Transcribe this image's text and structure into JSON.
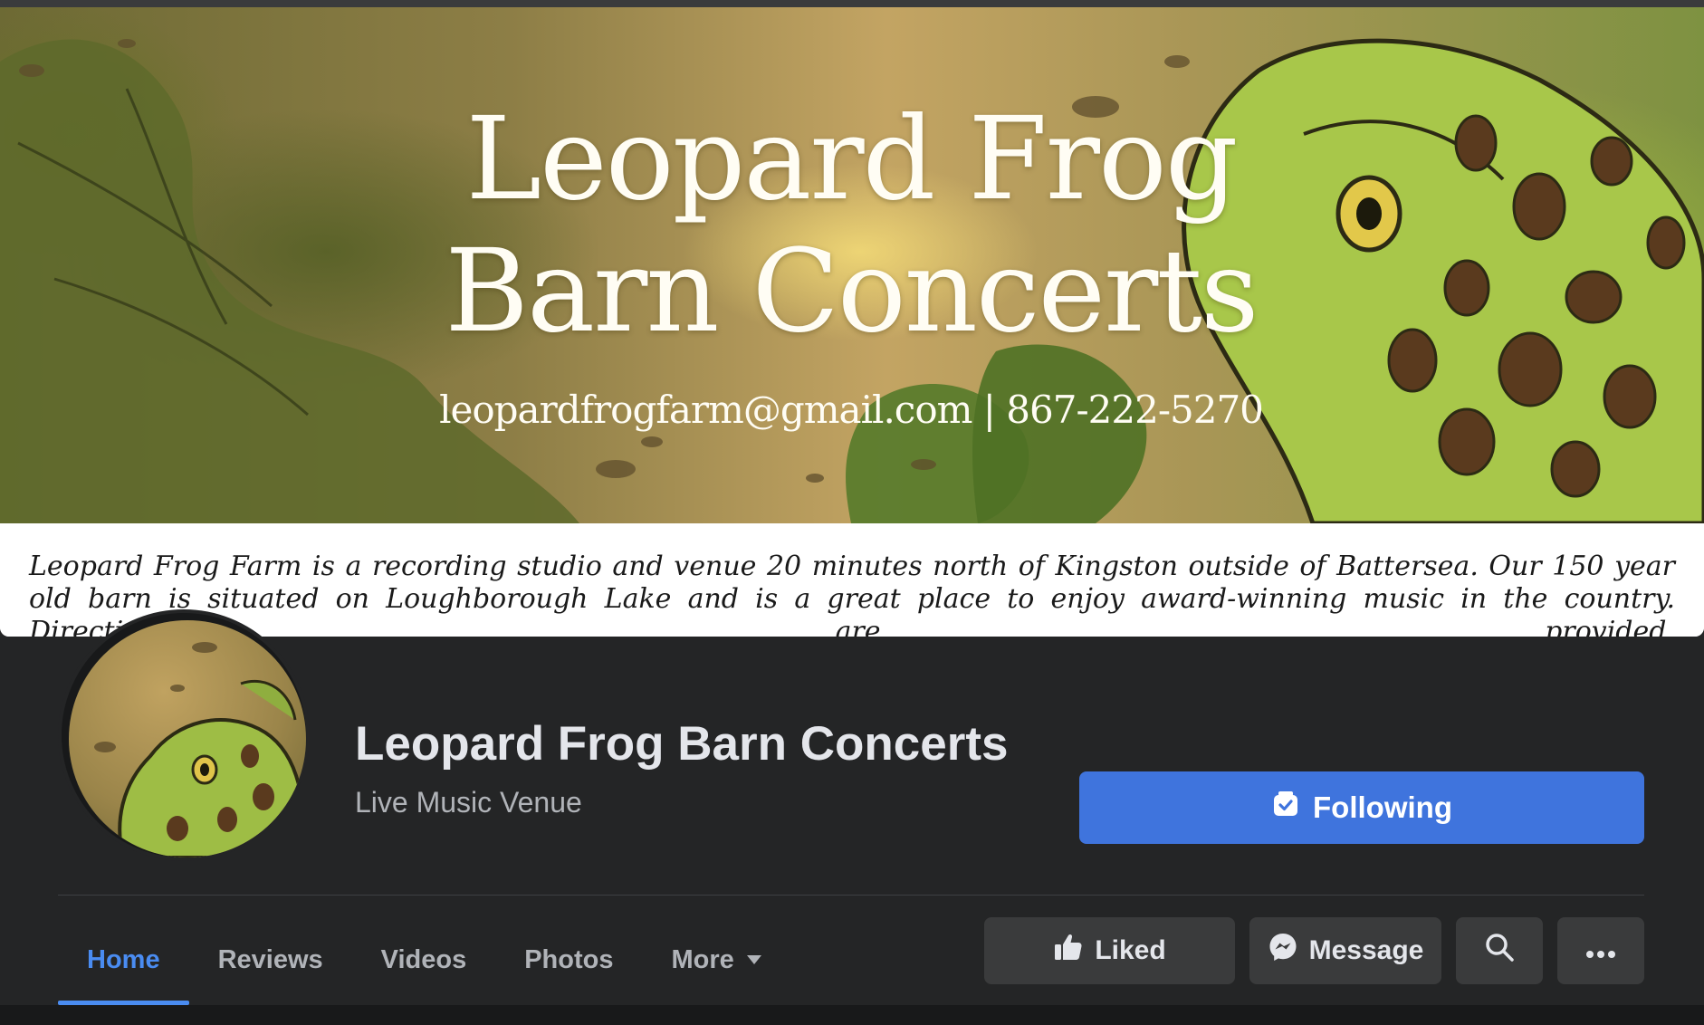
{
  "cover": {
    "title_line1": "Leopard Frog",
    "title_line2": "Barn Concerts",
    "contact": "leopardfrogfarm@gmail.com | 867-222-5270",
    "caption": "Leopard Frog Farm is a recording studio and venue 20 minutes north of Kingston outside of Battersea. Our 150 year old barn is situated on Loughborough Lake and is a great place to enjoy award-winning music in the country. Directions are provided."
  },
  "profile": {
    "name": "Leopard Frog Barn Concerts",
    "category": "Live Music Venue",
    "following_label": "Following",
    "following_icon": "following-check-icon"
  },
  "tabs": [
    {
      "label": "Home",
      "active": true
    },
    {
      "label": "Reviews",
      "active": false
    },
    {
      "label": "Videos",
      "active": false
    },
    {
      "label": "Photos",
      "active": false
    },
    {
      "label": "More",
      "active": false
    }
  ],
  "actions": {
    "liked_label": "Liked",
    "message_label": "Message",
    "search_icon": "search-icon",
    "more_icon": "more-dots-icon"
  },
  "colors": {
    "background": "#242526",
    "accent": "#3f74dd",
    "active_tab": "#4a8cf1",
    "text_primary": "#e4e6eb",
    "text_secondary": "#b0b3b8"
  }
}
